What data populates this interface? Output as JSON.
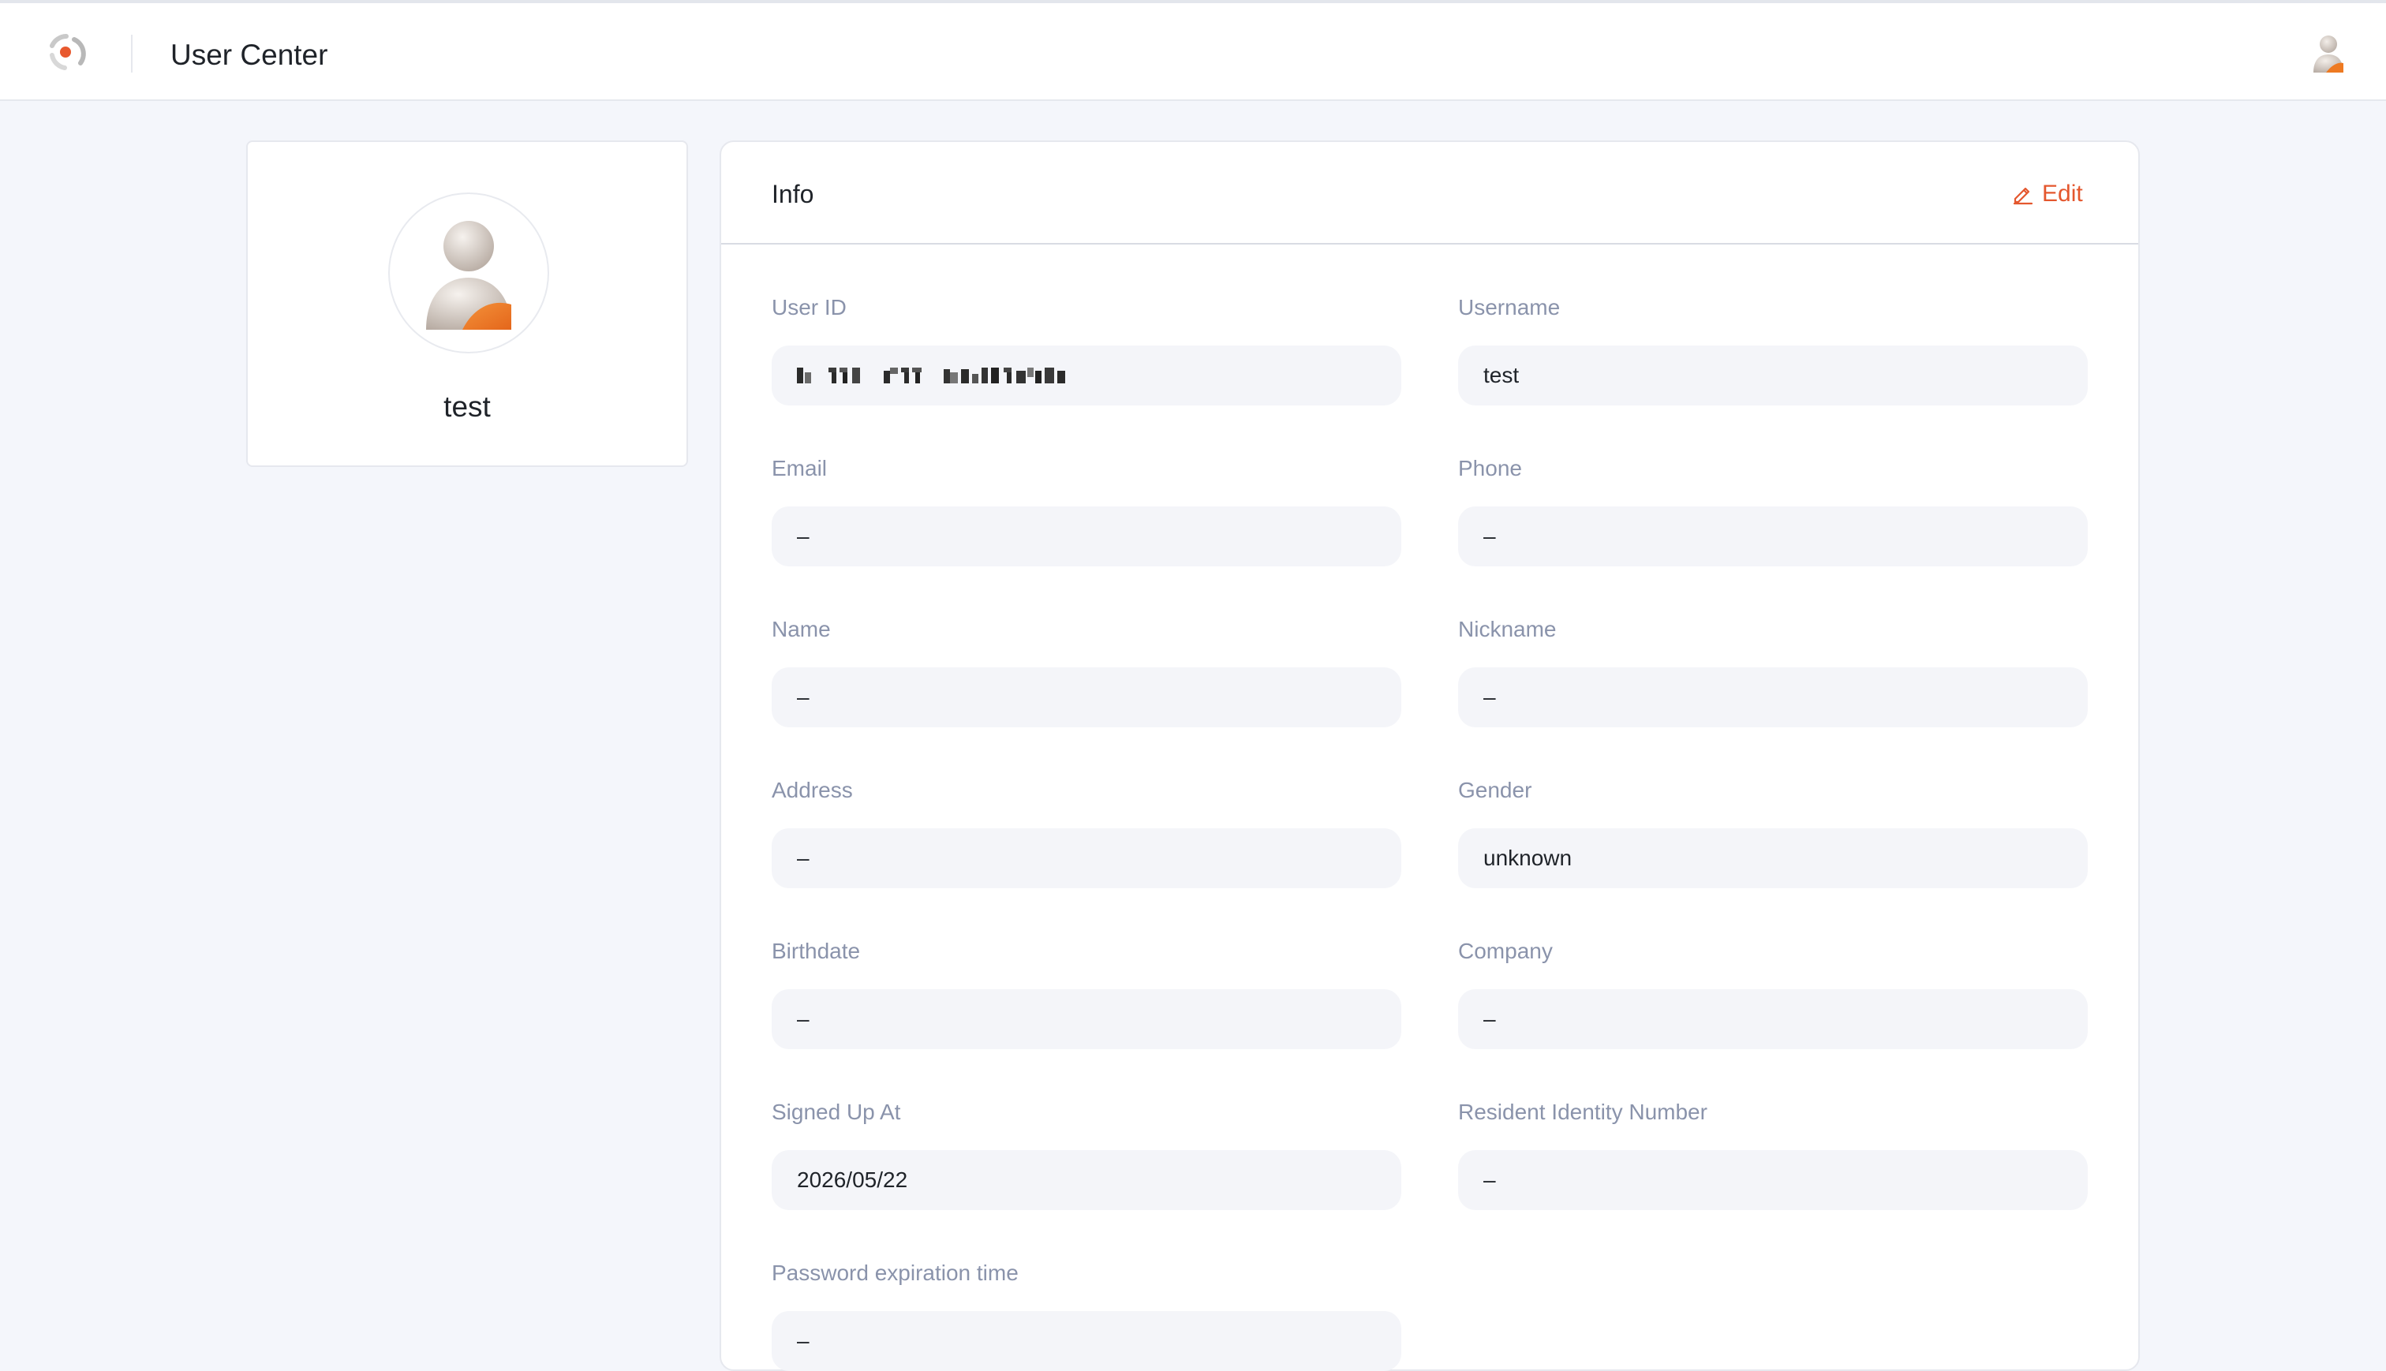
{
  "header": {
    "title": "User Center",
    "logo_icon": "app-logo-icon",
    "user_avatar_icon": "user-avatar-icon"
  },
  "profile": {
    "avatar_icon": "user-avatar-icon",
    "name": "test"
  },
  "info": {
    "title": "Info",
    "edit_label": "Edit",
    "edit_icon": "pencil-icon",
    "accent_color": "#e4572e",
    "fields": {
      "user_id": {
        "label": "User ID",
        "value": ""
      },
      "username": {
        "label": "Username",
        "value": "test"
      },
      "email": {
        "label": "Email",
        "value": "–"
      },
      "phone": {
        "label": "Phone",
        "value": "–"
      },
      "name": {
        "label": "Name",
        "value": "–"
      },
      "nickname": {
        "label": "Nickname",
        "value": "–"
      },
      "address": {
        "label": "Address",
        "value": "–"
      },
      "gender": {
        "label": "Gender",
        "value": "unknown"
      },
      "birthdate": {
        "label": "Birthdate",
        "value": "–"
      },
      "company": {
        "label": "Company",
        "value": "–"
      },
      "signed_up_at": {
        "label": "Signed Up At",
        "value": "2026/05/22"
      },
      "resident_id": {
        "label": "Resident Identity Number",
        "value": "–"
      },
      "password_expiration": {
        "label": "Password expiration time",
        "value": "–"
      }
    }
  }
}
